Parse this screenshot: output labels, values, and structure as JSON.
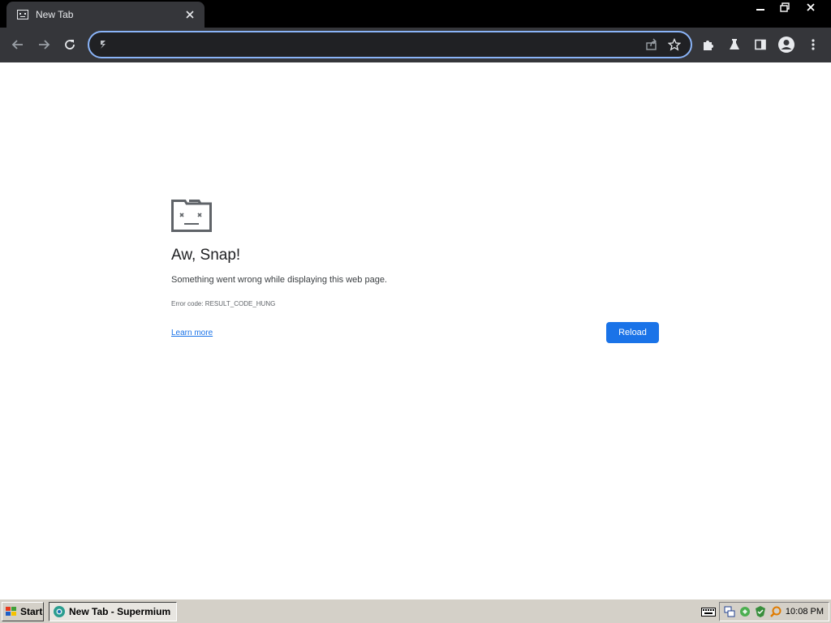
{
  "browser": {
    "tab": {
      "title": "New Tab",
      "favicon": "sad-tab-icon"
    },
    "window_controls": [
      "minimize",
      "restore",
      "close"
    ],
    "toolbar": {
      "back_icon": "arrow-left-icon",
      "forward_icon": "arrow-right-icon",
      "reload_icon": "reload-icon",
      "omnibox": {
        "value": "",
        "placeholder": "",
        "leading_icon": "supermium-icon",
        "trailing_icons": [
          "share-icon",
          "star-icon"
        ]
      },
      "extensions_icon": "puzzle-icon",
      "labs_icon": "flask-icon",
      "side_panel_icon": "side-panel-icon",
      "profile_icon": "profile-icon",
      "menu_icon": "kebab-menu-icon"
    },
    "colors": {
      "chrome_bg": "#35363a",
      "tabstrip_bg": "#000000",
      "omnibox_border": "#8ab4f8",
      "accent": "#1a73e8"
    }
  },
  "page": {
    "heading": "Aw, Snap!",
    "message": "Something went wrong while displaying this web page.",
    "error_code": "Error code: RESULT_CODE_HUNG",
    "learn_more": "Learn more",
    "reload_button": "Reload"
  },
  "taskbar": {
    "start_label": "Start",
    "task_label": "New Tab - Supermium",
    "clock": "10:08 PM",
    "tray_icons": [
      "keyboard-icon",
      "network-icon",
      "recycle-icon",
      "security-icon",
      "search-icon"
    ]
  }
}
